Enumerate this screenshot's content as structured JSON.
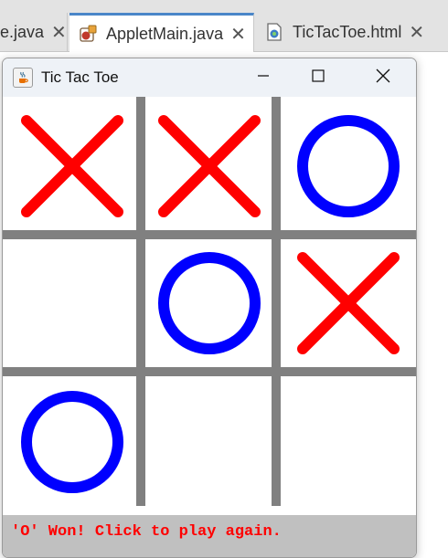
{
  "ide": {
    "tabs": [
      {
        "label": "e.java",
        "icon": "java-file-icon",
        "active": false
      },
      {
        "label": "AppletMain.java",
        "icon": "java-applet-file-icon",
        "active": true
      },
      {
        "label": "TicTacToe.html",
        "icon": "html-file-icon",
        "active": false
      }
    ],
    "close_glyph": "✕"
  },
  "window": {
    "title": "Tic Tac Toe",
    "icon": "java-cup-icon",
    "controls": [
      "minimize-icon",
      "maximize-icon",
      "close-icon"
    ]
  },
  "game": {
    "board": [
      [
        "X",
        "X",
        "O"
      ],
      [
        "",
        "O",
        "X"
      ],
      [
        "O",
        "",
        ""
      ]
    ],
    "colors": {
      "x": "#ff0000",
      "o": "#0000ff",
      "grid": "#808080",
      "status_text": "#ff0000",
      "status_bg": "#c0c0c0"
    },
    "status": "'O' Won! Click to play again."
  }
}
